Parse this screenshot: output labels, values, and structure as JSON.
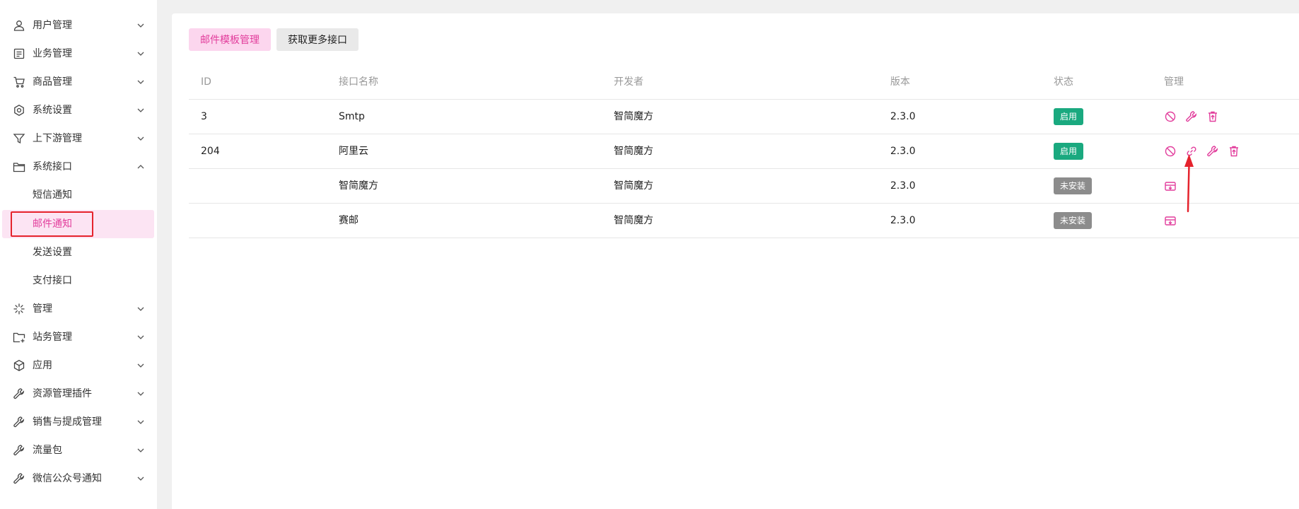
{
  "sidebar": {
    "items": [
      {
        "label": "用户管理",
        "icon": "user-icon",
        "expanded": false
      },
      {
        "label": "业务管理",
        "icon": "document-icon",
        "expanded": false
      },
      {
        "label": "商品管理",
        "icon": "cart-icon",
        "expanded": false
      },
      {
        "label": "系统设置",
        "icon": "hexagon-gear-icon",
        "expanded": false
      },
      {
        "label": "上下游管理",
        "icon": "filter-icon",
        "expanded": false
      },
      {
        "label": "系统接口",
        "icon": "folder-icon",
        "expanded": true
      }
    ],
    "sub_items": [
      {
        "label": "短信通知"
      },
      {
        "label": "邮件通知",
        "active": true
      },
      {
        "label": "发送设置"
      },
      {
        "label": "支付接口"
      }
    ],
    "items_after": [
      {
        "label": "管理",
        "icon": "sparkle-icon"
      },
      {
        "label": "站务管理",
        "icon": "folder-plus-icon"
      },
      {
        "label": "应用",
        "icon": "cube-icon"
      },
      {
        "label": "资源管理插件",
        "icon": "wrench-icon"
      },
      {
        "label": "销售与提成管理",
        "icon": "wrench-icon"
      },
      {
        "label": "流量包",
        "icon": "wrench-icon"
      },
      {
        "label": "微信公众号通知",
        "icon": "wrench-icon"
      }
    ]
  },
  "toolbar": {
    "template_btn": "邮件模板管理",
    "more_btn": "获取更多接口"
  },
  "table": {
    "headers": [
      "ID",
      "接口名称",
      "开发者",
      "版本",
      "状态",
      "管理"
    ],
    "rows": [
      {
        "id": "3",
        "name": "Smtp",
        "developer": "智简魔方",
        "version": "2.3.0",
        "status": "启用",
        "status_type": "enabled"
      },
      {
        "id": "204",
        "name": "阿里云",
        "developer": "智简魔方",
        "version": "2.3.0",
        "status": "启用",
        "status_type": "enabled"
      },
      {
        "id": "",
        "name": "智简魔方",
        "developer": "智简魔方",
        "version": "2.3.0",
        "status": "未安装",
        "status_type": "not-installed"
      },
      {
        "id": "",
        "name": "赛邮",
        "developer": "智简魔方",
        "version": "2.3.0",
        "status": "未安装",
        "status_type": "not-installed"
      }
    ]
  },
  "colors": {
    "accent": "#e23d9c",
    "enabled": "#1aa97f",
    "not_installed": "#8c8c8c",
    "highlight_box": "#e5232d"
  }
}
